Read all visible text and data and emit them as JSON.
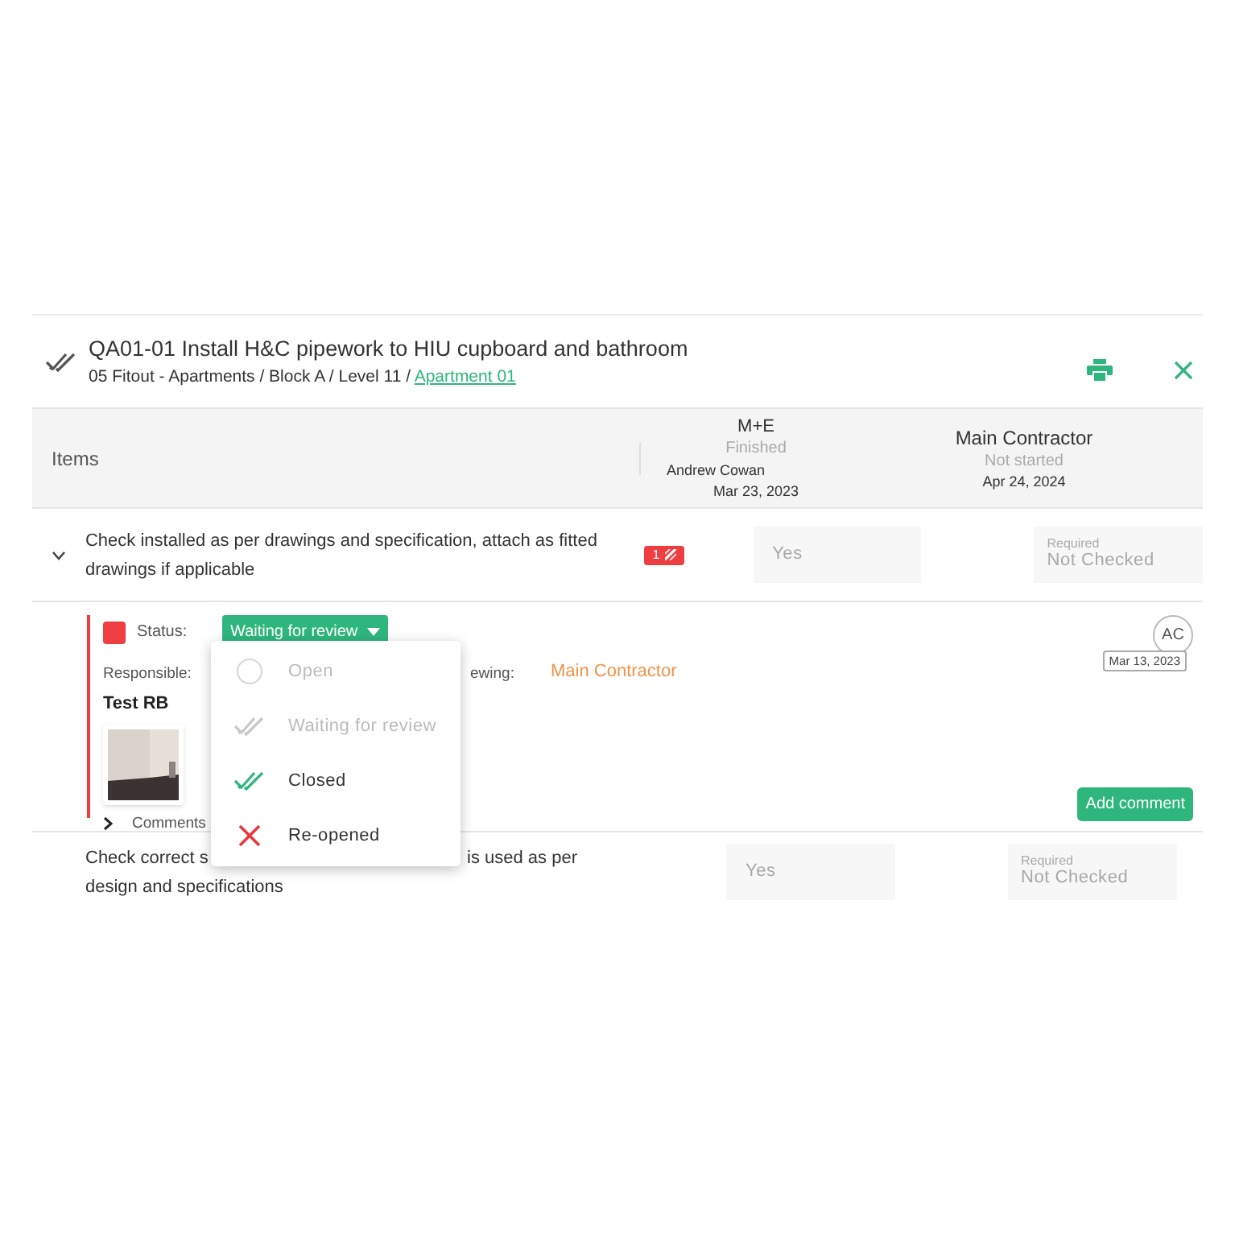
{
  "header": {
    "title": "QA01-01 Install H&C pipework to HIU cupboard and bathroom",
    "breadcrumb": "05 Fitout - Apartments / Block A / Level 11 /",
    "breadcrumb_link": "Apartment 01"
  },
  "table_header": {
    "items_label": "Items",
    "parties": [
      {
        "name": "M+E",
        "status": "Finished",
        "person": "Andrew Cowan",
        "date": "Mar 23, 2023"
      },
      {
        "name": "Main Contractor",
        "status": "Not started",
        "date": "Apr 24, 2024"
      }
    ]
  },
  "item1": {
    "text": "Check installed as per drawings and specification, attach as fitted drawings if applicable",
    "expanded": true,
    "badge": "1",
    "answer": "Yes",
    "required_label": "Required",
    "required_value": "Not Checked"
  },
  "detail": {
    "status_label": "Status:",
    "status_value": "Waiting for review",
    "responsible_label": "Responsible:",
    "responsible_value": "Test RB",
    "reviewing_label": "ewing:",
    "reviewing_value": "Main Contractor",
    "comments_label": "Comments",
    "comments_expanded": false,
    "avatar": "AC",
    "date": "Mar 13, 2023",
    "add_comment": "Add comment"
  },
  "dropdown": [
    {
      "label": "Open",
      "kind": "circle",
      "disabled": true
    },
    {
      "label": "Waiting for review",
      "kind": "double-check",
      "disabled": true
    },
    {
      "label": "Closed",
      "kind": "double-check",
      "disabled": false
    },
    {
      "label": "Re-opened",
      "kind": "cross",
      "disabled": false
    }
  ],
  "item2": {
    "text_start": "Check correct s",
    "text_end": "is used as per",
    "text_line2": "design and specifications",
    "answer": "Yes",
    "required_label": "Required",
    "required_value": "Not Checked"
  }
}
